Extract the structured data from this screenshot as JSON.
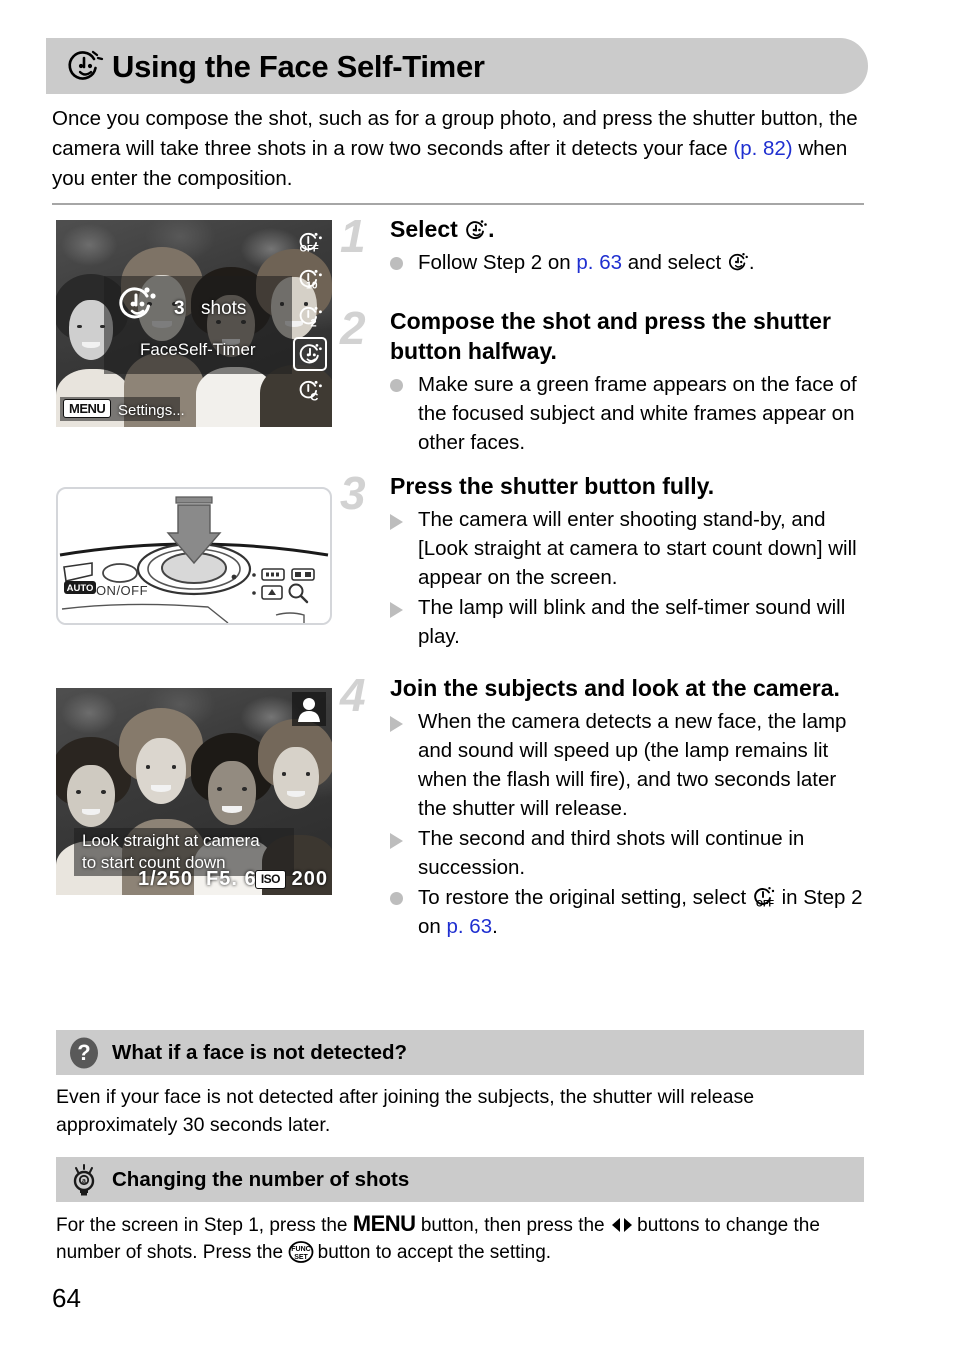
{
  "page": {
    "number": "64",
    "title": "Using the Face Self-Timer",
    "title_icon": "face-self-timer-icon",
    "intro": "Once you compose the shot, such as for a group photo, and press the shutter button, the camera will take three shots in a row two seconds after it detects your face ",
    "intro_link": "(p. 82)",
    "intro_tail": " when you enter the composition."
  },
  "steps": [
    {
      "number": "1",
      "heading_pre": "Select ",
      "heading_icon": "face-self-timer-icon",
      "heading_post": ".",
      "bullets": [
        {
          "marker": "dot",
          "text_pre": "Follow Step 2 on ",
          "link": "p. 63",
          "text_mid": " and select ",
          "icon": "face-self-timer-icon",
          "text_post": "."
        }
      ]
    },
    {
      "number": "2",
      "heading": "Compose the shot and press the shutter button halfway.",
      "bullets": [
        {
          "marker": "dot",
          "text": "Make sure a green frame appears on the face of the focused subject and white frames appear on other faces."
        }
      ]
    },
    {
      "number": "3",
      "heading": "Press the shutter button fully.",
      "bullets": [
        {
          "marker": "triangle",
          "text": "The camera will enter shooting stand-by, and [Look straight at camera to start count down] will appear on the screen."
        },
        {
          "marker": "triangle",
          "text": "The lamp will blink and the self-timer sound will play."
        }
      ]
    },
    {
      "number": "4",
      "heading": "Join the subjects and look at the camera.",
      "bullets": [
        {
          "marker": "triangle",
          "text": "When the camera detects a new face, the lamp and sound will speed up (the lamp remains lit when the flash will fire), and two seconds later the shutter will release."
        },
        {
          "marker": "triangle",
          "text": "The second and third shots will continue in succession."
        },
        {
          "marker": "dot",
          "text_pre": "To restore the original setting, select ",
          "icon": "self-timer-off-icon",
          "text_mid": " in Step 2 on ",
          "link": "p. 63",
          "text_post": "."
        }
      ]
    }
  ],
  "figures": {
    "lcd_menu": {
      "shots_label": "shots",
      "shots_count": "3",
      "mode_label": "FaceSelf-Timer",
      "menu_badge": "MENU",
      "menu_hint": "Settings...",
      "options": [
        {
          "name": "self-timer-off",
          "label": "OFF",
          "selected": false
        },
        {
          "name": "self-timer-10sec",
          "label": "10",
          "selected": false
        },
        {
          "name": "self-timer-2sec",
          "label": "2",
          "selected": false
        },
        {
          "name": "face-self-timer",
          "label": "",
          "selected": true
        },
        {
          "name": "custom-self-timer",
          "label": "C",
          "selected": false
        }
      ]
    },
    "camera_diagram": {
      "mode_badge": "AUTO",
      "power_label": "ON/OFF",
      "alt": "camera-top-shutter-button-press-diagram"
    },
    "lcd_countdown": {
      "message_line1": "Look straight at camera",
      "message_line2": "to start count down",
      "shutter_speed": "1/250",
      "aperture": "F5. 6",
      "iso_badge": "ISO",
      "iso_value": "200",
      "face_icon": "person-detected-icon"
    }
  },
  "callouts": [
    {
      "icon": "question-mark-icon",
      "title": "What if a face is not detected?",
      "body": "Even if your face is not detected after joining the subjects, the shutter will release approximately 30 seconds later."
    },
    {
      "icon": "lightbulb-icon",
      "title": "Changing the number of shots",
      "body_pre": "For the screen in Step 1, press the ",
      "body_menu": "MENU",
      "body_mid": " button, then press the ",
      "body_arrows": "left-right-buttons-icon",
      "body_mid2": " buttons to change the number of shots. Press the ",
      "body_func": "FUNC/SET",
      "body_post": " button to accept the setting."
    }
  ],
  "colors": {
    "header_gray": "#cbcbcb",
    "link_blue": "#1f2fd0",
    "step_num_gray": "#d2d2d2",
    "bullet_gray": "#bdbdbd",
    "rule_gray": "#a6a6a6"
  }
}
